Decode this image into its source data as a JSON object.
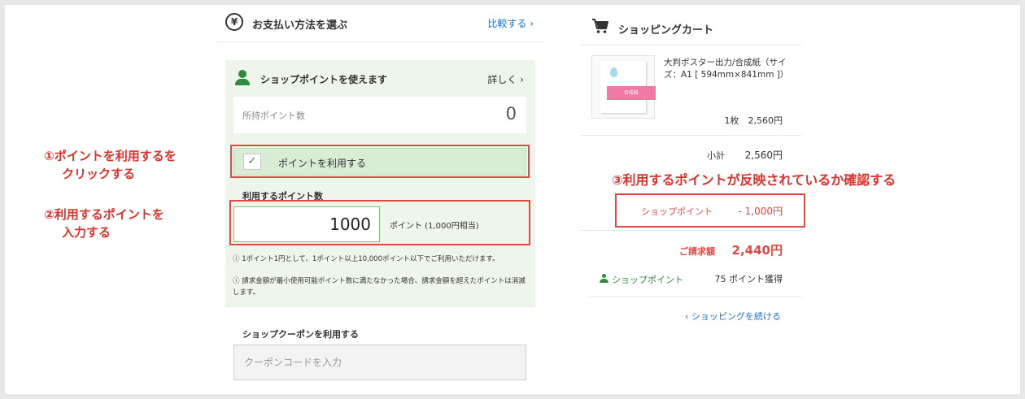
{
  "payment": {
    "title": "お支払い方法を選ぶ",
    "compare_link": "比較する ›",
    "yen_symbol": "¥"
  },
  "shop_point_panel": {
    "title": "ショップポイントを使えます",
    "detail_link": "詳しく ›",
    "owned_label": "所持ポイント数",
    "owned_value": "0",
    "use_checkbox_label": "ポイントを利用する",
    "use_checked": true,
    "check_mark": "✓",
    "amount_label": "利用するポイント数",
    "amount_value": "1000",
    "amount_suffix": "ポイント (1,000円相当)",
    "note1": "ⓘ 1ポイント1円として、1ポイント以上10,000ポイント以下でご利用いただけます。",
    "note2": "ⓘ 請求金額が最小使用可能ポイント数に満たなかった場合、請求金額を超えたポイントは消滅します。"
  },
  "coupon": {
    "label": "ショップクーポンを利用する",
    "placeholder": "クーポンコードを入力"
  },
  "annotations": {
    "step1_line1": "①ポイントを利用するを",
    "step1_line2": "クリックする",
    "step2_line1": "②利用するポイントを",
    "step2_line2": "入力する",
    "step3": "③利用するポイントが反映されているか確認する"
  },
  "cart": {
    "title": "ショッピングカート",
    "product_tag": "合成紙",
    "product_name": "大判ポスター出力/合成紙（サイズ：A1 [ 594mm×841mm ]）",
    "product_qty": "1枚　2,560円",
    "subtotal_label": "小計",
    "subtotal_value": "2,560円",
    "shop_point_label": "ショップポイント",
    "shop_point_value": "- 1,000円",
    "billing_label": "ご請求額",
    "billing_value": "2,440円",
    "earn_label": "ショップポイント",
    "earn_value": "75 ポイント獲得",
    "continue_link": "‹ ショッピングを続ける"
  },
  "colors": {
    "link_blue": "#1a6fd1",
    "accent_green": "#2e8b3e",
    "annotation_red": "#e0302a",
    "panel_bg": "#eef5ea"
  }
}
